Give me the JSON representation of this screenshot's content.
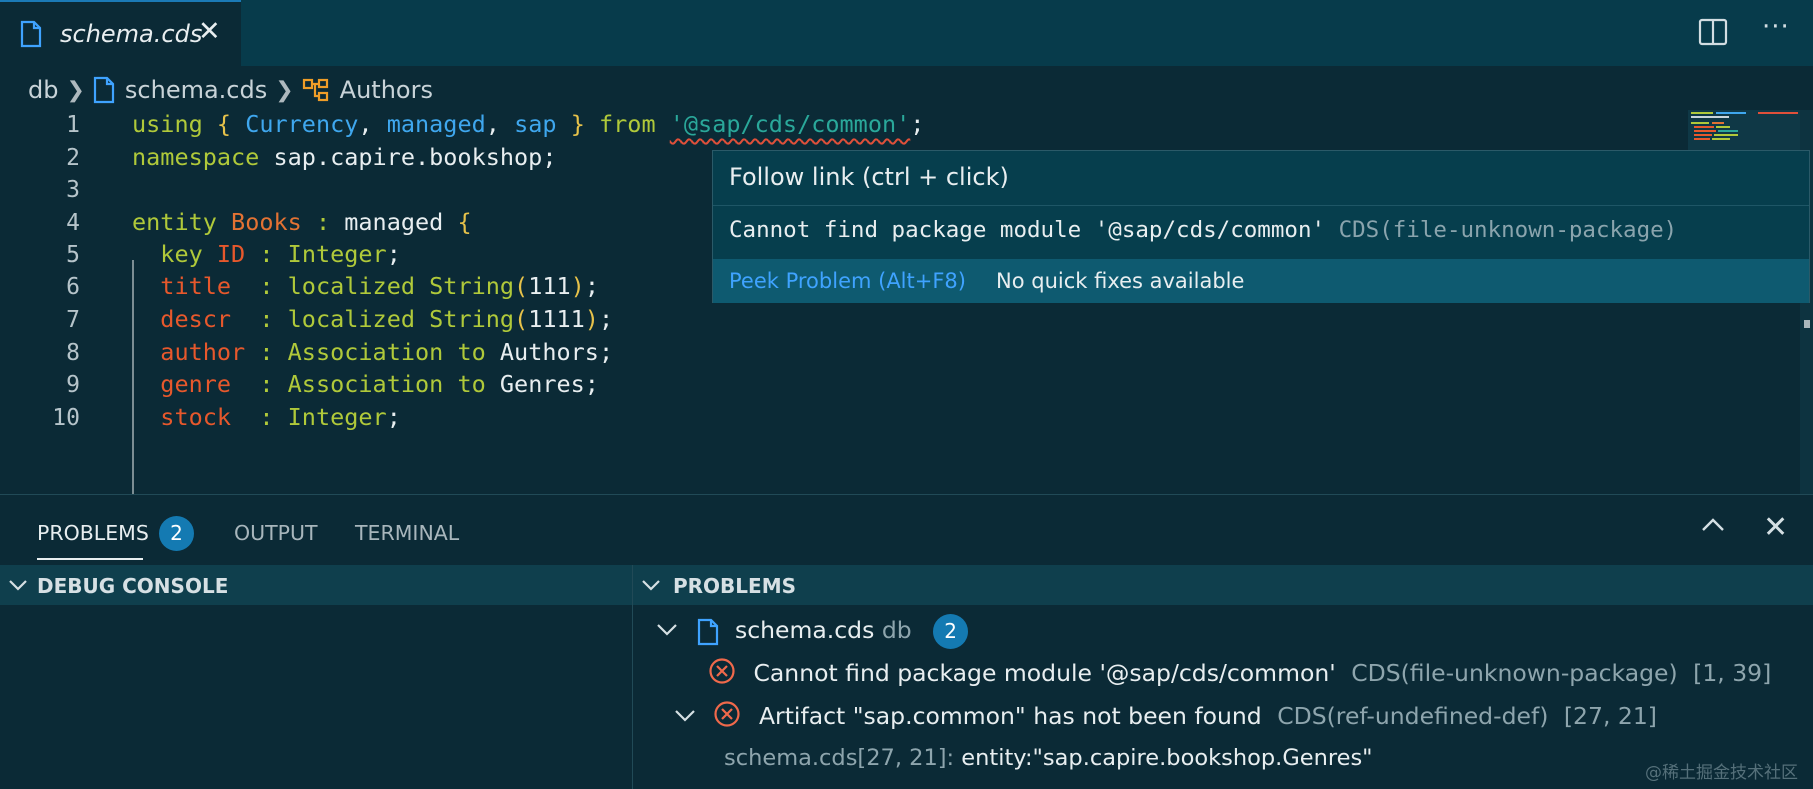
{
  "tab": {
    "title": "schema.cds"
  },
  "breadcrumb": {
    "folder": "db",
    "file": "schema.cds",
    "symbol": "Authors"
  },
  "editor": {
    "line_numbers": [
      "1",
      "2",
      "3",
      "4",
      "5",
      "6",
      "7",
      "8",
      "9",
      "10"
    ],
    "lines": {
      "l1": {
        "kw1": "using",
        "b1": "{",
        "t1": "Currency",
        "c1": ",",
        "t2": "managed",
        "c2": ",",
        "t3": "sap",
        "b2": "}",
        "kw2": "from",
        "str": "'@sap/cds/common'",
        "end": ";"
      },
      "l2": {
        "kw": "namespace",
        "name": "sap.capire.bookshop",
        "end": ";"
      },
      "l4": {
        "kw": "entity",
        "ent": "Books",
        "colon": ":",
        "aspect": "managed",
        "brace": "{"
      },
      "l5": {
        "kw": "key",
        "fld": "ID",
        "colon": ":",
        "type": "Integer",
        "end": ";"
      },
      "l6": {
        "fld": "title ",
        "colon": ":",
        "kw": "localized",
        "type": "String",
        "po": "(",
        "num": "111",
        "pc": ")",
        "end": ";"
      },
      "l7": {
        "fld": "descr ",
        "colon": ":",
        "kw": "localized",
        "type": "String",
        "po": "(",
        "num": "1111",
        "pc": ")",
        "end": ";"
      },
      "l8": {
        "fld": "author",
        "colon": ":",
        "kw": "Association",
        "to": "to",
        "target": "Authors",
        "end": ";"
      },
      "l9": {
        "fld": "genre ",
        "colon": ":",
        "kw": "Association",
        "to": "to",
        "target": "Genres",
        "end": ";"
      },
      "l10": {
        "fld": "stock ",
        "colon": ":",
        "type": "Integer",
        "end": ";"
      }
    }
  },
  "hover": {
    "link": "Follow link (ctrl + click)",
    "message": "Cannot find package module '@sap/cds/common'",
    "code": "CDS(file-unknown-package)",
    "peek": "Peek Problem (Alt+F8)",
    "no_fixes": "No quick fixes available"
  },
  "panel": {
    "tabs": {
      "problems": "PROBLEMS",
      "problems_count": "2",
      "output": "OUTPUT",
      "terminal": "TERMINAL"
    },
    "debug_console": "DEBUG CONSOLE",
    "problems_section": "PROBLEMS",
    "file": {
      "name": "schema.cds",
      "folder": "db",
      "count": "2"
    },
    "problems": [
      {
        "message": "Cannot find package module '@sap/cds/common'",
        "code": "CDS(file-unknown-package)",
        "location": "[1, 39]"
      },
      {
        "message": "Artifact \"sap.common\" has not been found",
        "code": "CDS(ref-undefined-def)",
        "location": "[27, 21]"
      }
    ],
    "related": {
      "location": "schema.cds[27, 21]:",
      "detail": "entity:\"sap.capire.bookshop.Genres\""
    }
  },
  "watermark": "@稀土掘金技术社区",
  "colors": {
    "accent": "#147ab2",
    "error": "#e0503a",
    "link": "#3fa3ff"
  }
}
